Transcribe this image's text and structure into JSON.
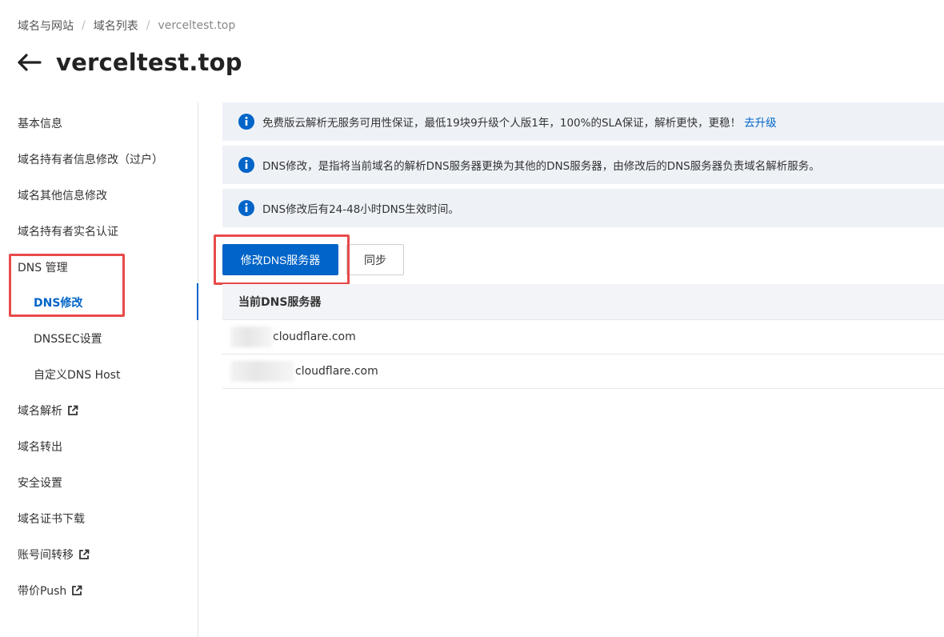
{
  "breadcrumb": {
    "items": [
      "域名与网站",
      "域名列表",
      "verceltest.top"
    ],
    "separator": "/"
  },
  "header": {
    "title": "verceltest.top",
    "back_icon": "arrow-left-icon"
  },
  "sidebar": {
    "items": [
      {
        "label": "基本信息"
      },
      {
        "label": "域名持有者信息修改（过户）"
      },
      {
        "label": "域名其他信息修改"
      },
      {
        "label": "域名持有者实名认证"
      },
      {
        "label": "DNS 管理"
      },
      {
        "label": "DNS修改"
      },
      {
        "label": "DNSSEC设置"
      },
      {
        "label": "自定义DNS Host"
      },
      {
        "label": "域名解析"
      },
      {
        "label": "域名转出"
      },
      {
        "label": "安全设置"
      },
      {
        "label": "域名证书下载"
      },
      {
        "label": "账号间转移"
      },
      {
        "label": "带价Push"
      }
    ]
  },
  "alerts": [
    {
      "text": "免费版云解析无服务可用性保证，最低19块9升级个人版1年，100%的SLA保证，解析更快，更稳！",
      "link": "去升级"
    },
    {
      "text": "DNS修改，是指将当前域名的解析DNS服务器更换为其他的DNS服务器，由修改后的DNS服务器负责域名解析服务。"
    },
    {
      "text": "DNS修改后有24-48小时DNS生效时间。"
    }
  ],
  "actions": {
    "modify_label": "修改DNS服务器",
    "sync_label": "同步"
  },
  "table": {
    "header": "当前DNS服务器",
    "rows": [
      {
        "value": "cloudflare.com"
      },
      {
        "value": "cloudflare.com"
      }
    ]
  },
  "colors": {
    "accent": "#0064c8",
    "highlight": "#e84a4a",
    "alert_bg": "#eef2f7"
  }
}
